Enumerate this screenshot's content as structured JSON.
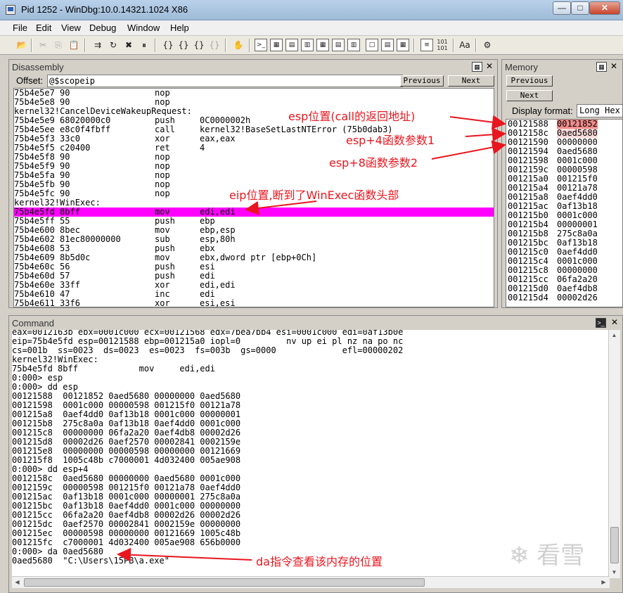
{
  "window": {
    "title": "Pid 1252 - WinDbg:10.0.14321.1024 X86",
    "controls": [
      "—",
      "□",
      "✕"
    ]
  },
  "menu": [
    "File",
    "Edit",
    "View",
    "Debug",
    "Window",
    "Help"
  ],
  "disassembly": {
    "title": "Disassembly",
    "offset_label": "Offset:",
    "offset_value": "@$scopeip",
    "prev_label": "Previous",
    "next_label": "Next",
    "lines": [
      [
        "75b4e5e7 90",
        "nop",
        ""
      ],
      [
        "75b4e5e8 90",
        "nop",
        ""
      ],
      [
        "kernel32!CancelDeviceWakeupRequest:",
        "",
        ""
      ],
      [
        "75b4e5e9 68020000c0",
        "push",
        "0C0000002h"
      ],
      [
        "75b4e5ee e8c0f4fbff",
        "call",
        "kernel32!BaseSetLastNTError (75b0dab3)"
      ],
      [
        "75b4e5f3 33c0",
        "xor",
        "eax,eax"
      ],
      [
        "75b4e5f5 c20400",
        "ret",
        "4"
      ],
      [
        "75b4e5f8 90",
        "nop",
        ""
      ],
      [
        "75b4e5f9 90",
        "nop",
        ""
      ],
      [
        "75b4e5fa 90",
        "nop",
        ""
      ],
      [
        "75b4e5fb 90",
        "nop",
        ""
      ],
      [
        "75b4e5fc 90",
        "nop",
        ""
      ],
      [
        "kernel32!WinExec:",
        "",
        ""
      ],
      [
        "75b4e5fd 8bff",
        "mov",
        "edi,edi"
      ],
      [
        "75b4e5ff 55",
        "push",
        "ebp"
      ],
      [
        "75b4e600 8bec",
        "mov",
        "ebp,esp"
      ],
      [
        "75b4e602 81ec80000000",
        "sub",
        "esp,80h"
      ],
      [
        "75b4e608 53",
        "push",
        "ebx"
      ],
      [
        "75b4e609 8b5d0c",
        "mov",
        "ebx,dword ptr [ebp+0Ch]"
      ],
      [
        "75b4e60c 56",
        "push",
        "esi"
      ],
      [
        "75b4e60d 57",
        "push",
        "edi"
      ],
      [
        "75b4e60e 33ff",
        "xor",
        "edi,edi"
      ],
      [
        "75b4e610 47",
        "inc",
        "edi"
      ],
      [
        "75b4e611 33f6",
        "xor",
        "esi,esi"
      ]
    ]
  },
  "memory": {
    "title": "Memory",
    "prev_label": "Previous",
    "next_label": "Next",
    "format_label": "Display format:",
    "format_value": "Long Hex",
    "rows": [
      [
        "00121588",
        "00121852"
      ],
      [
        "0012158c",
        "0aed5680"
      ],
      [
        "00121590",
        "00000000"
      ],
      [
        "00121594",
        "0aed5680"
      ],
      [
        "00121598",
        "0001c000"
      ],
      [
        "0012159c",
        "00000598"
      ],
      [
        "001215a0",
        "001215f0"
      ],
      [
        "001215a4",
        "00121a78"
      ],
      [
        "001215a8",
        "0aef4dd0"
      ],
      [
        "001215ac",
        "0af13b18"
      ],
      [
        "001215b0",
        "0001c000"
      ],
      [
        "001215b4",
        "00000001"
      ],
      [
        "001215b8",
        "275c8a0a"
      ],
      [
        "001215bc",
        "0af13b18"
      ],
      [
        "001215c0",
        "0aef4dd0"
      ],
      [
        "001215c4",
        "0001c000"
      ],
      [
        "001215c8",
        "00000000"
      ],
      [
        "001215cc",
        "06fa2a20"
      ],
      [
        "001215d0",
        "0aef4db8"
      ],
      [
        "001215d4",
        "00002d26"
      ]
    ]
  },
  "command": {
    "title": "Command",
    "lines": [
      "eax=0012163b ebx=0001c000 ecx=00121568 edx=7bea7bb4 esi=0001c000 edi=0af13b0e",
      "eip=75b4e5fd esp=00121588 ebp=001215a0 iopl=0         nv up ei pl nz na po nc",
      "cs=001b  ss=0023  ds=0023  es=0023  fs=003b  gs=0000             efl=00000202",
      "kernel32!WinExec:",
      "75b4e5fd 8bff            mov     edi,edi",
      "0:000> esp",
      "0:000> dd esp",
      "00121588  00121852 0aed5680 00000000 0aed5680",
      "00121598  0001c000 00000598 001215f0 00121a78",
      "001215a8  0aef4dd0 0af13b18 0001c000 00000001",
      "001215b8  275c8a0a 0af13b18 0aef4dd0 0001c000",
      "001215c8  00000000 06fa2a20 0aef4db8 00002d26",
      "001215d8  00002d26 0aef2570 00002841 0002159e",
      "001215e8  00000000 00000598 00000000 00121669",
      "001215f8  1005c48b c7000001 4d032400 005ae908",
      "0:000> dd esp+4",
      "0012158c  0aed5680 00000000 0aed5680 0001c000",
      "0012159c  00000598 001215f0 00121a78 0aef4dd0",
      "001215ac  0af13b18 0001c000 00000001 275c8a0a",
      "001215bc  0af13b18 0aef4dd0 0001c000 00000000",
      "001215cc  06fa2a20 0aef4db8 00002d26 00002d26",
      "001215dc  0aef2570 00002841 0002159e 00000000",
      "001215ec  00000598 00000000 00121669 1005c48b",
      "001215fc  c7000001 4d032400 005ae908 656b0000",
      "0:000> da 0aed5680",
      "0aed5680  \"C:\\Users\\15PB\\a.exe\""
    ]
  },
  "annotations": {
    "esp_pos": "esp位置(call的返回地址)",
    "esp4": "esp+4函数参数1",
    "esp8": "esp+8函数参数2",
    "eip_pos": "eip位置,断到了WinExec函数头部",
    "da_cmd": "da指令查看该内存的位置"
  },
  "watermark": "看雪",
  "colors": {
    "eip_highlight": "#ff00ff",
    "esp_highlight": "#f08a8a",
    "param_highlight": "#fcdada",
    "annotation": "#e8161e"
  }
}
